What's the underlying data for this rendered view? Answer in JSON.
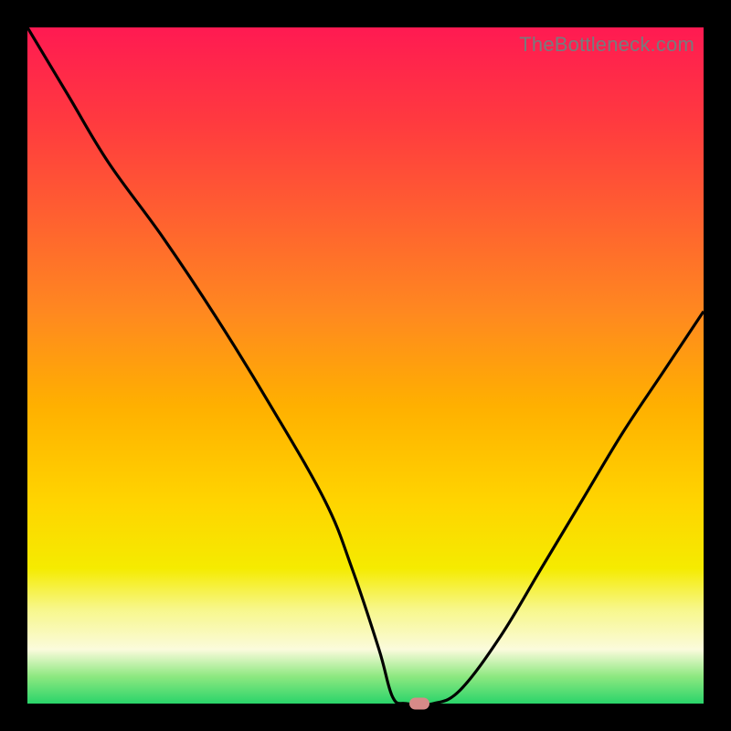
{
  "watermark": "TheBottleneck.com",
  "colors": {
    "curve": "#000000",
    "marker": "#d78a88",
    "gradient_top": "#ff1a52",
    "gradient_bottom": "#2ad46a"
  },
  "chart_data": {
    "type": "line",
    "title": "",
    "xlabel": "",
    "ylabel": "",
    "xlim": [
      0,
      100
    ],
    "ylim": [
      0,
      100
    ],
    "grid": false,
    "series": [
      {
        "name": "bottleneck-curve",
        "x": [
          0,
          6,
          12,
          20,
          28,
          36,
          44,
          48,
          52,
          54,
          56,
          60,
          64,
          70,
          76,
          82,
          88,
          94,
          100
        ],
        "values": [
          100,
          90,
          80,
          69,
          57,
          44,
          30,
          20,
          8,
          1,
          0,
          0,
          2,
          10,
          20,
          30,
          40,
          49,
          58
        ]
      }
    ],
    "marker": {
      "x": 58,
      "y": 0
    },
    "annotations": []
  }
}
